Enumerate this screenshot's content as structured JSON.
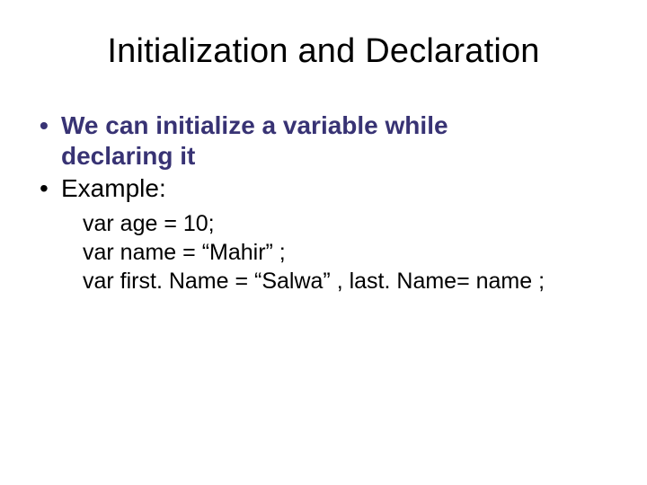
{
  "title": "Initialization and Declaration",
  "bullets": {
    "b1_line1": "We can initialize a variable while",
    "b1_line2": "declaring it",
    "b2": "Example:"
  },
  "code": {
    "l1": "var age = 10;",
    "l2": "var name = “Mahir” ;",
    "l3": "var first. Name = “Salwa” , last. Name= name ;"
  }
}
